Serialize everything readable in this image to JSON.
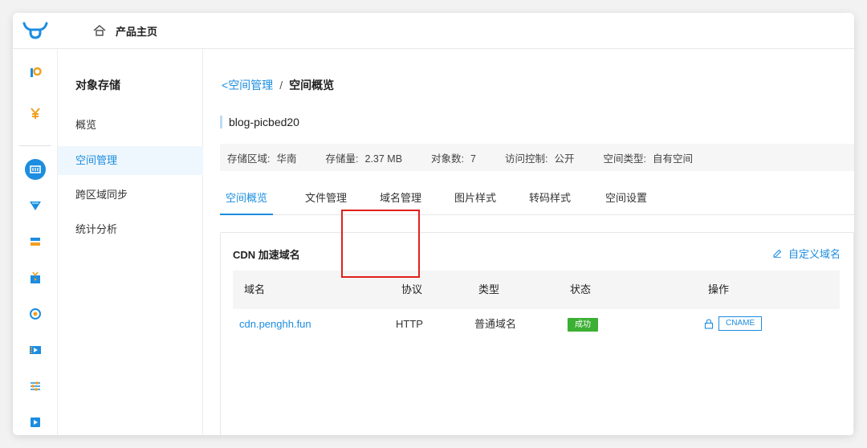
{
  "topbar": {
    "home_label": "产品主页"
  },
  "colors": {
    "accent": "#1c8de0",
    "success": "#3cb034",
    "highlight": "#e0211b"
  },
  "icons": {
    "logo": "bull-logo-icon",
    "home": "home-icon",
    "sidebar": [
      "pandora-icon",
      "billing-yen-icon",
      "object-storage-icon",
      "cdn-icon",
      "server-icon",
      "live-icon",
      "intelligent-icon",
      "video-icon",
      "settings-sliders-icon",
      "media-icon"
    ]
  },
  "menu": {
    "title": "对象存储",
    "items": [
      {
        "label": "概览"
      },
      {
        "label": "空间管理"
      },
      {
        "label": "跨区域同步"
      },
      {
        "label": "统计分析"
      }
    ],
    "active": "空间管理"
  },
  "breadcrumb": {
    "back_label": "空间管理",
    "separator": "/",
    "current": "空间概览"
  },
  "bucket": {
    "name": "blog-picbed20",
    "meta": [
      {
        "label": "存储区域:",
        "value": "华南"
      },
      {
        "label": "存储量:",
        "value": "2.37 MB"
      },
      {
        "label": "对象数:",
        "value": "7"
      },
      {
        "label": "访问控制:",
        "value": "公开"
      },
      {
        "label": "空间类型:",
        "value": "自有空间"
      }
    ]
  },
  "tabs": [
    {
      "label": "空间概览"
    },
    {
      "label": "文件管理"
    },
    {
      "label": "域名管理"
    },
    {
      "label": "图片样式"
    },
    {
      "label": "转码样式"
    },
    {
      "label": "空间设置"
    }
  ],
  "cdn_panel": {
    "title": "CDN 加速域名",
    "custom_domain_label": "自定义域名",
    "columns": [
      "域名",
      "协议",
      "类型",
      "状态",
      "操作"
    ],
    "rows": [
      {
        "domain": "cdn.penghh.fun",
        "protocol": "HTTP",
        "type": "普通域名",
        "status": "成功",
        "action": "CNAME"
      }
    ]
  }
}
